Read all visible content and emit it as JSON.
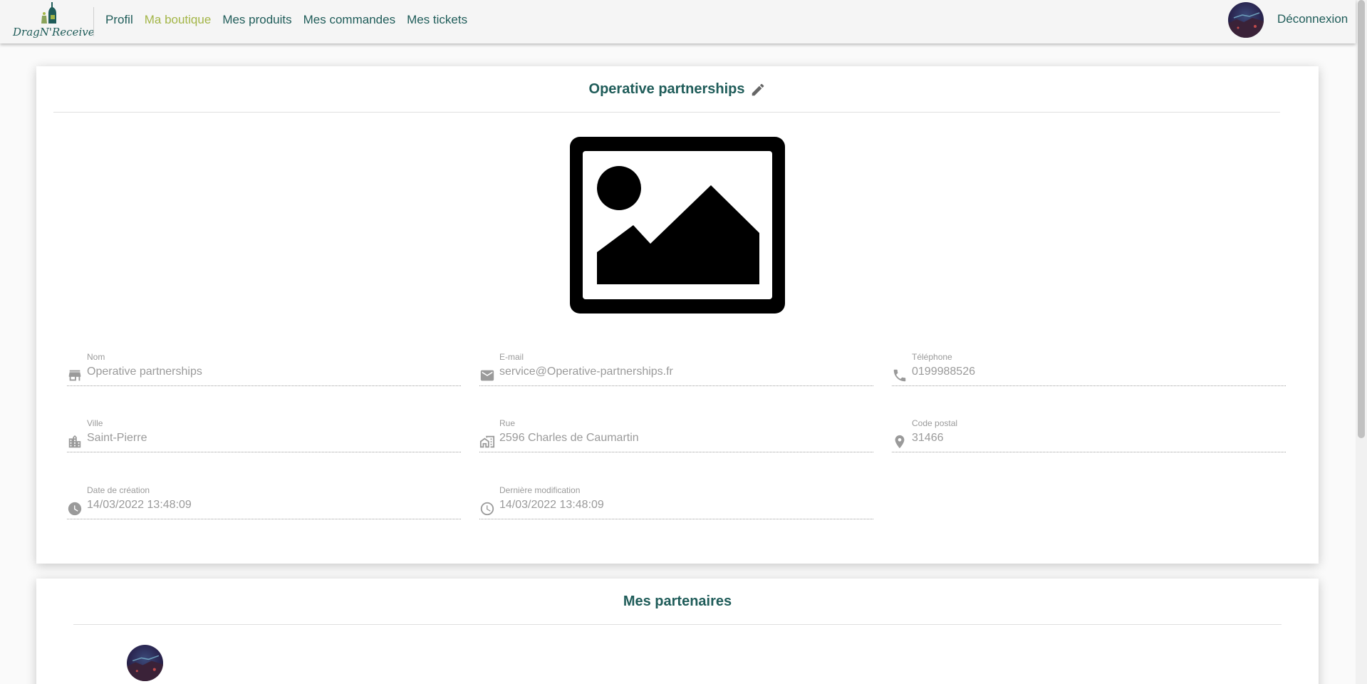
{
  "app": {
    "logo_text": "DragN'Receive",
    "colors": {
      "primary": "#1f5c59",
      "active_nav": "#a3b547",
      "muted_text": "#9a9a9a"
    }
  },
  "nav": {
    "items": [
      {
        "label": "Profil",
        "active": false
      },
      {
        "label": "Ma boutique",
        "active": true
      },
      {
        "label": "Mes produits",
        "active": false
      },
      {
        "label": "Mes commandes",
        "active": false
      },
      {
        "label": "Mes tickets",
        "active": false
      }
    ],
    "logout_label": "Déconnexion"
  },
  "shop": {
    "title": "Operative partnerships",
    "image_icon": "image-placeholder-icon",
    "fields": {
      "name": {
        "label": "Nom",
        "value": "Operative partnerships",
        "icon": "store-icon"
      },
      "email": {
        "label": "E-mail",
        "value": "service@Operative-partnerships.fr",
        "icon": "mail-icon"
      },
      "phone": {
        "label": "Téléphone",
        "value": "0199988526",
        "icon": "phone-icon"
      },
      "city": {
        "label": "Ville",
        "value": "Saint-Pierre",
        "icon": "city-icon"
      },
      "street": {
        "label": "Rue",
        "value": "2596 Charles de Caumartin",
        "icon": "street-icon"
      },
      "postcode": {
        "label": "Code postal",
        "value": "31466",
        "icon": "location-pin-icon"
      },
      "created": {
        "label": "Date de création",
        "value": "14/03/2022 13:48:09",
        "icon": "clock-filled-icon"
      },
      "modified": {
        "label": "Dernière modification",
        "value": "14/03/2022 13:48:09",
        "icon": "clock-outline-icon"
      }
    }
  },
  "partners": {
    "title": "Mes partenaires"
  }
}
